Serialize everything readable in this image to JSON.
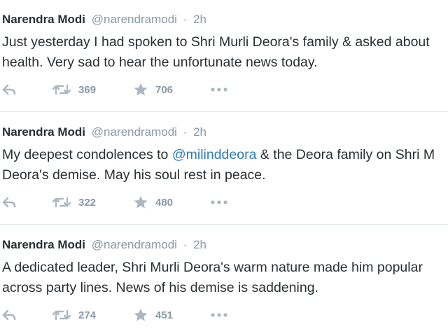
{
  "tweets": [
    {
      "name": "Narendra Modi",
      "handle": "@narendramodi",
      "separator": "·",
      "time": "2h",
      "line1": "Just yesterday I had spoken to Shri Murli Deora's family & asked about",
      "line2": "health. Very sad to hear the unfortunate news today.",
      "retweets": "369",
      "favorites": "706"
    },
    {
      "name": "Narendra Modi",
      "handle": "@narendramodi",
      "separator": "·",
      "time": "2h",
      "line1_before": "My deepest condolences to ",
      "line1_mention": "@milinddeora",
      "line1_after": " & the Deora family on Shri M",
      "line2": "Deora's demise. May his soul rest in peace.",
      "retweets": "322",
      "favorites": "480"
    },
    {
      "name": "Narendra Modi",
      "handle": "@narendramodi",
      "separator": "·",
      "time": "2h",
      "line1": "A dedicated leader, Shri Murli Deora's warm nature made him popular",
      "line2": "across party lines. News of his demise is saddening.",
      "retweets": "274",
      "favorites": "451"
    }
  ],
  "icons": {
    "reply": "reply-icon",
    "retweet": "retweet-icon",
    "favorite": "star-icon",
    "more": "more-options-icon"
  },
  "colors": {
    "name": "#292f33",
    "muted": "#8899a6",
    "mention": "#2b7bb9",
    "divider": "#e1e8ed"
  }
}
